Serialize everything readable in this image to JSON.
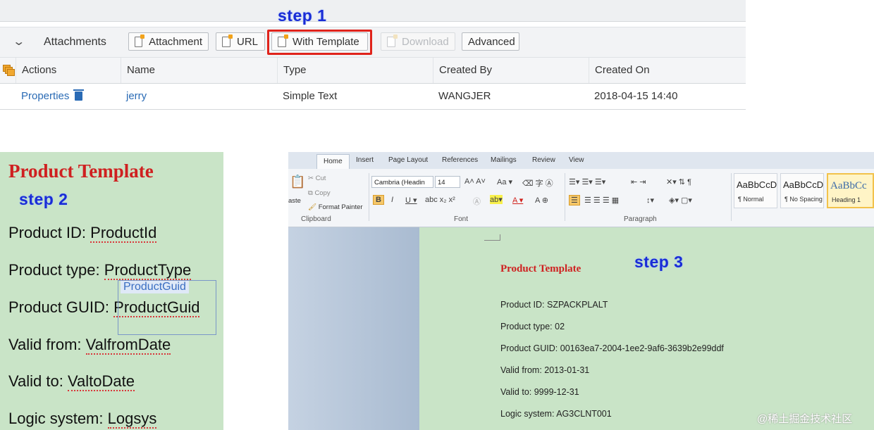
{
  "steps": {
    "step1": "step 1",
    "step2": "step 2",
    "step3": "step 3"
  },
  "attachments": {
    "title": "Attachments",
    "buttons": {
      "attachment": "Attachment",
      "url": "URL",
      "with_template": "With Template",
      "download": "Download",
      "advanced": "Advanced"
    },
    "columns": [
      "Actions",
      "Name",
      "Type",
      "Created By",
      "Created On"
    ],
    "rows": [
      {
        "action": "Properties",
        "name": "jerry",
        "type": "Simple Text",
        "created_by": "WANGJER",
        "created_on": "2018-04-15 14:40"
      }
    ]
  },
  "template_card": {
    "title": "Product Template",
    "lines": [
      {
        "label": "Product ID:",
        "field": "ProductId"
      },
      {
        "label": "Product type:",
        "field": "ProductType"
      },
      {
        "label": "Product GUID:",
        "field": "ProductGuid"
      },
      {
        "label": "Valid from:",
        "field": "ValfromDate"
      },
      {
        "label": "Valid to:",
        "field": "ValtoDate"
      },
      {
        "label": "Logic system:",
        "field": "Logsys"
      }
    ],
    "field_tag": "ProductGuid"
  },
  "word": {
    "tabs": [
      "Home",
      "Insert",
      "Page Layout",
      "References",
      "Mailings",
      "Review",
      "View"
    ],
    "clipboard": {
      "paste": "aste",
      "cut": "Cut",
      "copy": "Copy",
      "format_painter": "Format Painter",
      "group": "Clipboard"
    },
    "font": {
      "name": "Cambria (Headin",
      "size": "14",
      "group": "Font"
    },
    "paragraph_group": "Paragraph",
    "styles": [
      {
        "sample": "AaBbCcD",
        "name": "¶ Normal"
      },
      {
        "sample": "AaBbCcD",
        "name": "¶ No Spacing"
      },
      {
        "sample": "AaBbCc",
        "name": "Heading 1"
      }
    ],
    "document": {
      "title": "Product Template",
      "lines": [
        "Product ID: SZPACKPLALT",
        "Product type: 02",
        "Product GUID: 00163ea7-2004-1ee2-9af6-3639b2e99ddf",
        "Valid from: 2013-01-31",
        "Valid to: 9999-12-31",
        "Logic system: AG3CLNT001"
      ]
    }
  },
  "watermark": "@稀土掘金技术社区"
}
